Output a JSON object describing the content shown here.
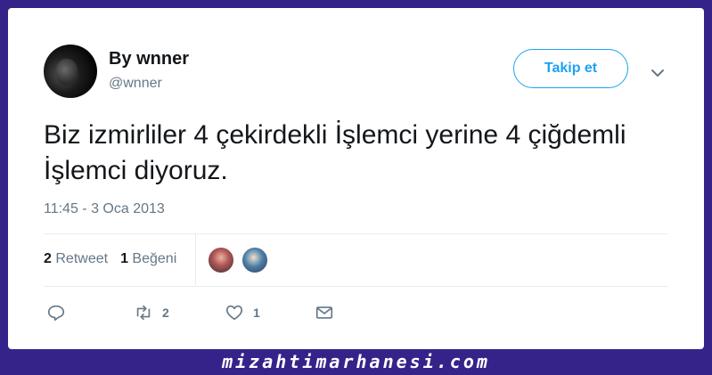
{
  "user": {
    "display_name": "By wnner",
    "handle": "@wnner"
  },
  "follow_button": {
    "label": "Takip et"
  },
  "tweet": {
    "text": "Biz izmirliler 4 çekirdekli İşlemci yerine 4 çiğdemli İşlemci diyoruz.",
    "timestamp": "11:45 - 3 Oca 2013"
  },
  "stats": {
    "retweets_count": "2",
    "retweets_label": "Retweet",
    "likes_count": "1",
    "likes_label": "Beğeni"
  },
  "actions": {
    "reply_icon": "reply-icon",
    "retweet_icon": "retweet-icon",
    "retweet_count": "2",
    "like_icon": "heart-icon",
    "like_count": "1",
    "message_icon": "envelope-icon"
  },
  "watermark": "mizahtimarhanesi.com",
  "colors": {
    "background": "#35238a",
    "accent": "#1da1f2",
    "muted": "#657786"
  }
}
